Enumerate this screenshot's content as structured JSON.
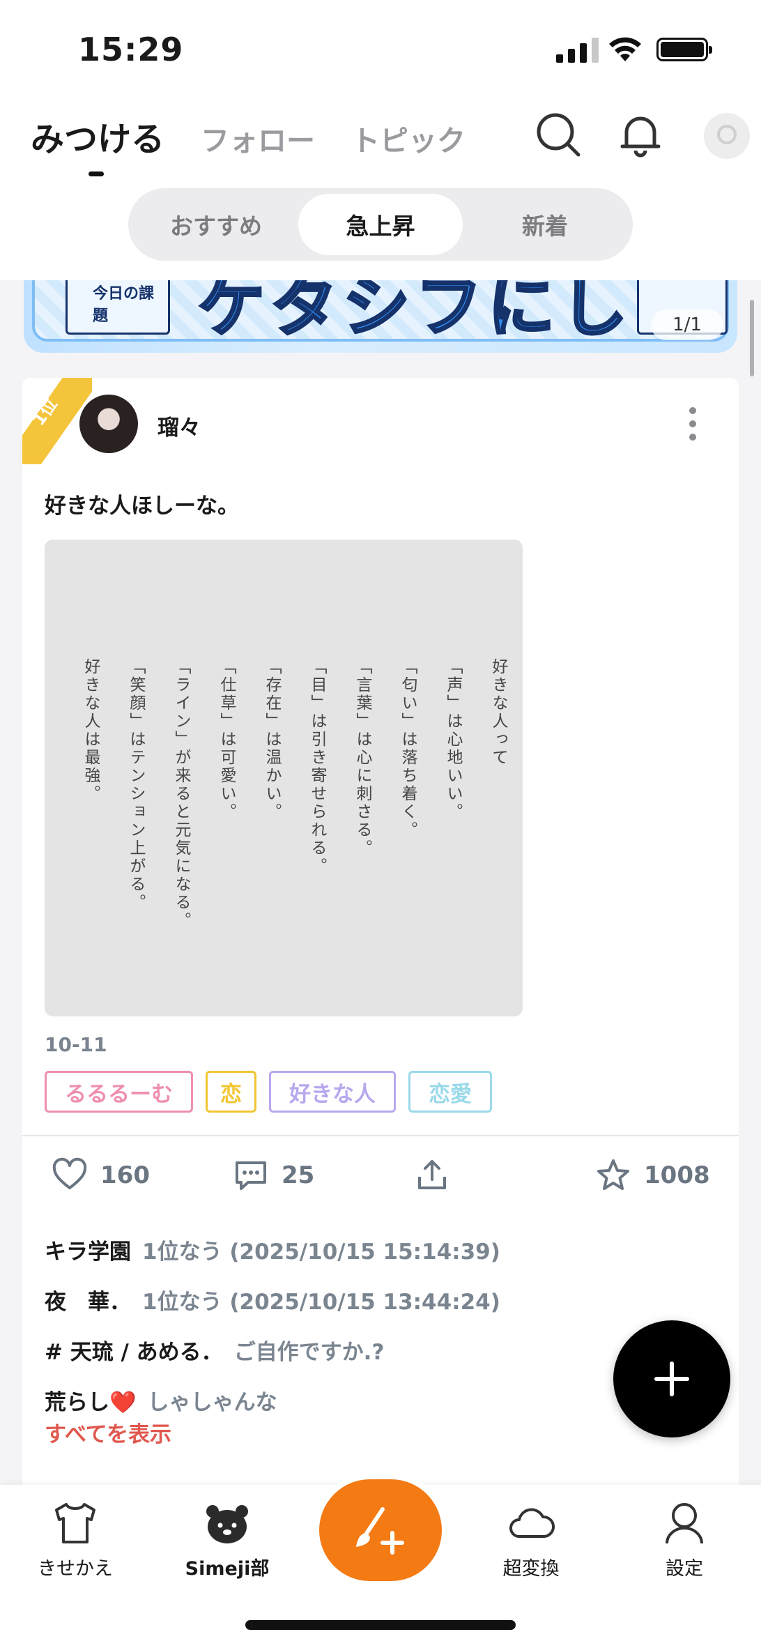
{
  "status_bar": {
    "time": "15:29"
  },
  "header": {
    "tabs": [
      {
        "label": "みつける",
        "active": true
      },
      {
        "label": "フォロー",
        "active": false
      },
      {
        "label": "トピック",
        "active": false
      }
    ],
    "icons": [
      "search-icon",
      "bell-icon",
      "avatar"
    ],
    "segments": [
      {
        "label": "おすすめ",
        "active": false
      },
      {
        "label": "急上昇",
        "active": true
      },
      {
        "label": "新着",
        "active": false
      }
    ]
  },
  "banner": {
    "title": "ケタシフにして？",
    "card_label": "今日の課題",
    "pager": "1/1"
  },
  "post": {
    "rank": "1位",
    "username": "瑠々",
    "text": "好きな人ほしーな。",
    "image_lines": [
      "好きな人って",
      "「声」は心地いい。",
      "「匂い」は落ち着く。",
      "「言葉」は心に刺さる。",
      "「目」は引き寄せられる。",
      "「存在」は温かい。",
      "「仕草」は可愛い。",
      "「ライン」が来ると元気になる。",
      "「笑顔」はテンション上がる。",
      "好きな人は最強。"
    ],
    "date": "10-11",
    "tags": [
      {
        "label": "るるるーむ",
        "color": "#ef8fb0"
      },
      {
        "label": "恋",
        "color": "#f2c531"
      },
      {
        "label": "好きな人",
        "color": "#b9a7ee"
      },
      {
        "label": "恋愛",
        "color": "#9ad9ea"
      }
    ],
    "likes": "160",
    "comments_count": "25",
    "favorites": "1008",
    "comments": [
      {
        "user": "キラ学園",
        "text": "1位なう (2025/10/15 15:14:39)"
      },
      {
        "user": "夜　華．",
        "text": "1位なう (2025/10/15 13:44:24)"
      },
      {
        "user": "# 天琉 / あめる．",
        "text": "ご自作ですか.?"
      },
      {
        "user": "荒らし❤️",
        "text": "しゃしゃんな"
      }
    ],
    "show_all": "すべてを表示"
  },
  "bottom_nav": [
    {
      "label": "きせかえ",
      "icon": "shirt-icon"
    },
    {
      "label": "Simeji部",
      "icon": "bear-icon"
    },
    {
      "label": "",
      "icon": "brush-plus-icon"
    },
    {
      "label": "超変換",
      "icon": "cloud-icon"
    },
    {
      "label": "設定",
      "icon": "person-icon"
    }
  ],
  "colors": {
    "accent": "#f47a14",
    "rank_badge": "#f4c53b",
    "show_all": "#e0574e"
  }
}
